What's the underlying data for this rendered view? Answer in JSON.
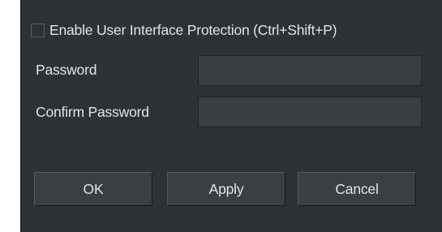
{
  "protection": {
    "checkbox_label": "Enable User Interface Protection (Ctrl+Shift+P)",
    "checked": false
  },
  "fields": {
    "password_label": "Password",
    "password_value": "",
    "confirm_label": "Confirm Password",
    "confirm_value": ""
  },
  "buttons": {
    "ok_label": "OK",
    "apply_label": "Apply",
    "cancel_label": "Cancel"
  },
  "colors": {
    "background": "#2e3135",
    "input_background": "#3a3d42",
    "button_background": "#3b3f44",
    "text": "#e2e4e6"
  }
}
